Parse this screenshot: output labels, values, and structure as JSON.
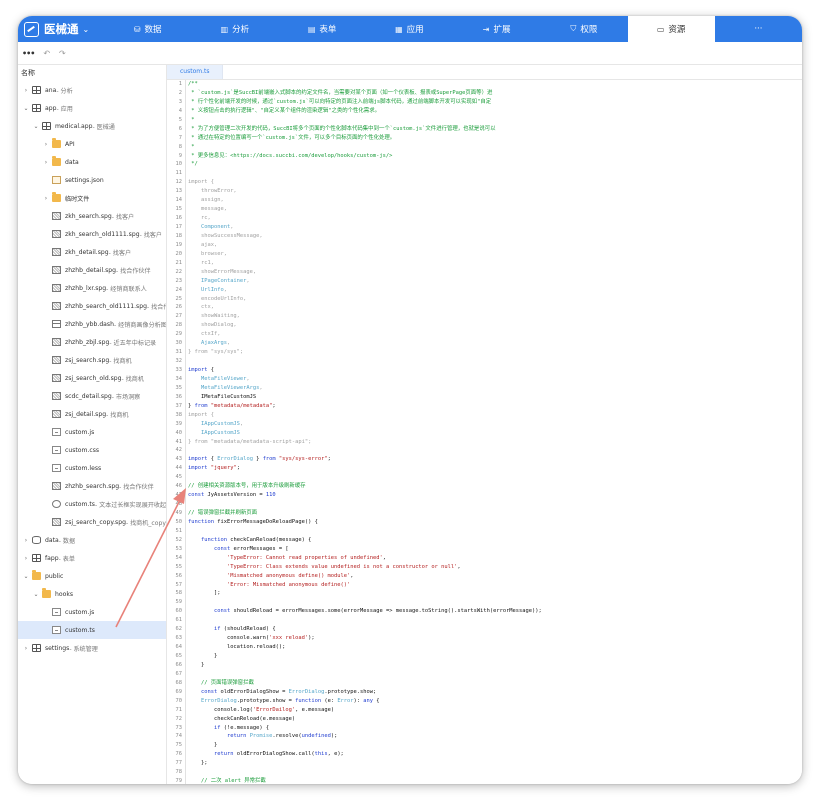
{
  "app": {
    "name": "医械通",
    "caret": "⌄"
  },
  "nav": [
    {
      "icon": "db",
      "label": "数据"
    },
    {
      "icon": "chart",
      "label": "分析"
    },
    {
      "icon": "table",
      "label": "表单"
    },
    {
      "icon": "grid",
      "label": "应用"
    },
    {
      "icon": "ext",
      "label": "扩展"
    },
    {
      "icon": "shield",
      "label": "权限"
    },
    {
      "icon": "folder",
      "label": "资源",
      "active": true
    },
    {
      "icon": "",
      "label": "···"
    }
  ],
  "subbar": {
    "menu": "•••",
    "undo": "↶",
    "redo": "↷"
  },
  "sidebar": {
    "header": "名称",
    "rows": [
      {
        "arrow": "›",
        "icon": "app",
        "label": "ana",
        "desc": " - 分析",
        "indent": 0
      },
      {
        "arrow": "⌄",
        "icon": "app",
        "label": "app",
        "desc": " - 应用",
        "indent": 0
      },
      {
        "arrow": "⌄",
        "icon": "app",
        "label": "medical.app",
        "desc": " - 医械通",
        "indent": 1
      },
      {
        "arrow": "›",
        "icon": "folder",
        "label": "API",
        "desc": "",
        "indent": 2
      },
      {
        "arrow": "›",
        "icon": "folder",
        "label": "data",
        "desc": "",
        "indent": 2
      },
      {
        "arrow": "",
        "icon": "json",
        "label": "settings.json",
        "desc": "",
        "indent": 2
      },
      {
        "arrow": "›",
        "icon": "folder",
        "label": "临时文件",
        "desc": "",
        "indent": 2
      },
      {
        "arrow": "",
        "icon": "spg",
        "label": "zkh_search.spg",
        "desc": " - 找客户",
        "indent": 2
      },
      {
        "arrow": "",
        "icon": "spg",
        "label": "zkh_search_old1111.spg",
        "desc": " - 找客户",
        "indent": 2
      },
      {
        "arrow": "",
        "icon": "spg",
        "label": "zkh_detail.spg",
        "desc": " - 找客户",
        "indent": 2
      },
      {
        "arrow": "",
        "icon": "spg",
        "label": "zhzhb_detail.spg",
        "desc": " - 找合作伙伴",
        "indent": 2
      },
      {
        "arrow": "",
        "icon": "spg",
        "label": "zhzhb_lxr.spg",
        "desc": " - 经销商联系人",
        "indent": 2
      },
      {
        "arrow": "",
        "icon": "spg",
        "label": "zhzhb_search_old1111.spg",
        "desc": " - 找合作伙伴",
        "indent": 2
      },
      {
        "arrow": "",
        "icon": "dash",
        "label": "zhzhb_ybb.dash",
        "desc": " - 经销商画像分析图",
        "indent": 2
      },
      {
        "arrow": "",
        "icon": "spg",
        "label": "zhzhb_zbjl.spg",
        "desc": " - 近五年中标记录",
        "indent": 2
      },
      {
        "arrow": "",
        "icon": "spg",
        "label": "zsj_search.spg",
        "desc": " - 找商机",
        "indent": 2
      },
      {
        "arrow": "",
        "icon": "spg",
        "label": "zsj_search_old.spg",
        "desc": " - 找商机",
        "indent": 2
      },
      {
        "arrow": "",
        "icon": "spg",
        "label": "scdc_detail.spg",
        "desc": " - 市场洞察",
        "indent": 2
      },
      {
        "arrow": "",
        "icon": "spg",
        "label": "zsj_detail.spg",
        "desc": " - 找商机",
        "indent": 2
      },
      {
        "arrow": "",
        "icon": "file",
        "label": "custom.js",
        "desc": "",
        "indent": 2
      },
      {
        "arrow": "",
        "icon": "file",
        "label": "custom.css",
        "desc": "",
        "indent": 2
      },
      {
        "arrow": "",
        "icon": "file",
        "label": "custom.less",
        "desc": "",
        "indent": 2
      },
      {
        "arrow": "",
        "icon": "spg",
        "label": "zhzhb_search.spg",
        "desc": " - 找合作伙伴",
        "indent": 2
      },
      {
        "arrow": "",
        "icon": "cmp",
        "label": "custom.ts",
        "desc": " - 文本过长框实现展开收起",
        "indent": 2
      },
      {
        "arrow": "",
        "icon": "spg",
        "label": "zsj_search_copy.spg",
        "desc": " - 找商机_copy",
        "indent": 2
      },
      {
        "arrow": "›",
        "icon": "db",
        "label": "data",
        "desc": " - 数据",
        "indent": 0
      },
      {
        "arrow": "›",
        "icon": "app",
        "label": "fapp",
        "desc": " - 表单",
        "indent": 0
      },
      {
        "arrow": "⌄",
        "icon": "folder",
        "label": "public",
        "desc": "",
        "indent": 0
      },
      {
        "arrow": "⌄",
        "icon": "folder",
        "label": "hooks",
        "desc": "",
        "indent": 1
      },
      {
        "arrow": "",
        "icon": "file",
        "label": "custom.js",
        "desc": "",
        "indent": 2
      },
      {
        "arrow": "",
        "icon": "file",
        "label": "custom.ts",
        "desc": "",
        "indent": 2,
        "selected": true
      },
      {
        "arrow": "›",
        "icon": "app",
        "label": "settings",
        "desc": " - 系统管理",
        "indent": 0
      }
    ]
  },
  "editor": {
    "tab": "custom.ts",
    "colors": {
      "comment": "#1a9c3a",
      "keyword": "#1f3ccf",
      "string": "#b31d1d",
      "gray": "#a0a0a0",
      "cyan": "#55a6c9",
      "text": "#111111",
      "num": "#1f3ccf"
    },
    "lines": [
      [
        [
          "c",
          "/**"
        ]
      ],
      [
        [
          "c",
          " * `custom.js`是SuccBI前端嵌入式脚本的约定文件名，当需要对某个页面（如一个仪表板、报表或SuperPage页面等）进"
        ]
      ],
      [
        [
          "c",
          " * 行个性化前端开发的时候，通过`custom.js`可以向特定的页面注入前端js脚本代码，通过前端脚本开发可以实现如\"自定"
        ]
      ],
      [
        [
          "c",
          " * 义按钮点击的执行逻辑\"、\"自定义某个组件的渲染逻辑\"之类的个性化需求。"
        ]
      ],
      [
        [
          "c",
          " *"
        ]
      ],
      [
        [
          "c",
          " * 为了方便管理二次开发的代码，SuccBI将多个页面的个性化脚本代码集中到一个`custom.js`文件进行管理，也就是说可以"
        ]
      ],
      [
        [
          "c",
          " * 通过在特定的位置编写一个`custom.js`文件，可以多个目标页面的个性化处理。"
        ]
      ],
      [
        [
          "c",
          " *"
        ]
      ],
      [
        [
          "c",
          " * 更多信息见：<https://docs.succbi.com/develop/hooks/custom-js/>"
        ]
      ],
      [
        [
          "c",
          " */"
        ]
      ],
      [],
      [
        [
          "g",
          "import {"
        ]
      ],
      [
        [
          "g",
          "    throwError,"
        ]
      ],
      [
        [
          "g",
          "    assign,"
        ]
      ],
      [
        [
          "g",
          "    message,"
        ]
      ],
      [
        [
          "g",
          "    rc,"
        ]
      ],
      [
        [
          "y",
          "    Component"
        ],
        [
          "g",
          ","
        ]
      ],
      [
        [
          "g",
          "    showSuccessMessage,"
        ]
      ],
      [
        [
          "g",
          "    ajax,"
        ]
      ],
      [
        [
          "g",
          "    browser,"
        ]
      ],
      [
        [
          "g",
          "    rc1,"
        ]
      ],
      [
        [
          "g",
          "    showErrorMessage,"
        ]
      ],
      [
        [
          "y",
          "    IPageContainer"
        ],
        [
          "g",
          ","
        ]
      ],
      [
        [
          "y",
          "    UrlInfo"
        ],
        [
          "g",
          ","
        ]
      ],
      [
        [
          "g",
          "    encodeUrlInfo,"
        ]
      ],
      [
        [
          "g",
          "    ctx,"
        ]
      ],
      [
        [
          "g",
          "    showWaiting,"
        ]
      ],
      [
        [
          "g",
          "    showDialog,"
        ]
      ],
      [
        [
          "g",
          "    ctxIf,"
        ]
      ],
      [
        [
          "y",
          "    AjaxArgs"
        ],
        [
          "g",
          ","
        ]
      ],
      [
        [
          "g",
          "} from \"sys/sys\";"
        ]
      ],
      [],
      [
        [
          "k",
          "import"
        ],
        [
          "t",
          " {"
        ]
      ],
      [
        [
          "y",
          "    MetaFileViewer"
        ],
        [
          "g",
          ","
        ]
      ],
      [
        [
          "y",
          "    MetaFileViewerArgs"
        ],
        [
          "g",
          ","
        ]
      ],
      [
        [
          "t",
          "    IMetaFileCustomJS"
        ]
      ],
      [
        [
          "t",
          "} "
        ],
        [
          "k",
          "from"
        ],
        [
          "t",
          " "
        ],
        [
          "s",
          "\"metadata/metadata\""
        ],
        [
          "t",
          ";"
        ]
      ],
      [
        [
          "g",
          "import {"
        ]
      ],
      [
        [
          "y",
          "    IAppCustomJS"
        ],
        [
          "g",
          ","
        ]
      ],
      [
        [
          "y",
          "    IAppCustomJS"
        ]
      ],
      [
        [
          "g",
          "} from \"metadata/metadata-script-api\";"
        ]
      ],
      [],
      [
        [
          "k",
          "import"
        ],
        [
          "t",
          " { "
        ],
        [
          "y",
          "ErrorDialog"
        ],
        [
          "t",
          " } "
        ],
        [
          "k",
          "from"
        ],
        [
          "t",
          " "
        ],
        [
          "s",
          "\"sys/sys-error\""
        ],
        [
          "t",
          ";"
        ]
      ],
      [
        [
          "k",
          "import"
        ],
        [
          "t",
          " "
        ],
        [
          "s",
          "\"jquery\""
        ],
        [
          "t",
          ";"
        ]
      ],
      [],
      [
        [
          "c",
          "// 创建相关资源版本号，用于版本升级刷新缓存"
        ]
      ],
      [
        [
          "k",
          "const"
        ],
        [
          "t",
          " JyAssetsVersion = "
        ],
        [
          "n",
          "110"
        ]
      ],
      [],
      [
        [
          "c",
          "// 错误弹窗拦截并刷新页面"
        ]
      ],
      [
        [
          "k",
          "function"
        ],
        [
          "t",
          " fixErrorMessageDoReloadPage() {"
        ]
      ],
      [],
      [
        [
          "t",
          "    "
        ],
        [
          "k",
          "function"
        ],
        [
          "t",
          " checkCanReload(message) {"
        ]
      ],
      [
        [
          "t",
          "        "
        ],
        [
          "k",
          "const"
        ],
        [
          "t",
          " errorMessages = ["
        ]
      ],
      [
        [
          "t",
          "            "
        ],
        [
          "s",
          "'TypeError: Cannot read properties of undefined'"
        ],
        [
          "t",
          ","
        ]
      ],
      [
        [
          "t",
          "            "
        ],
        [
          "s",
          "'TypeError: Class extends value undefined is not a constructor or null'"
        ],
        [
          "t",
          ","
        ]
      ],
      [
        [
          "t",
          "            "
        ],
        [
          "s",
          "'Mismatched anonymous define() module'"
        ],
        [
          "t",
          ","
        ]
      ],
      [
        [
          "t",
          "            "
        ],
        [
          "s",
          "'Error: Mismatched anonymous define()'"
        ]
      ],
      [
        [
          "t",
          "        ];"
        ]
      ],
      [],
      [
        [
          "t",
          "        "
        ],
        [
          "k",
          "const"
        ],
        [
          "t",
          " shouldReload = errorMessages.some(errorMessage => message.toString().startsWith(errorMessage));"
        ]
      ],
      [],
      [
        [
          "t",
          "        "
        ],
        [
          "k",
          "if"
        ],
        [
          "t",
          " (shouldReload) {"
        ]
      ],
      [
        [
          "t",
          "            console.warn("
        ],
        [
          "s",
          "'xxx reload'"
        ],
        [
          "t",
          ");"
        ]
      ],
      [
        [
          "t",
          "            location.reload();"
        ]
      ],
      [
        [
          "t",
          "        }"
        ]
      ],
      [
        [
          "t",
          "    }"
        ]
      ],
      [],
      [
        [
          "t",
          "    "
        ],
        [
          "c",
          "// 页面错误弹窗拦截"
        ]
      ],
      [
        [
          "t",
          "    "
        ],
        [
          "k",
          "const"
        ],
        [
          "t",
          " oldErrorDialogShow = "
        ],
        [
          "y",
          "ErrorDialog"
        ],
        [
          "t",
          ".prototype.show;"
        ]
      ],
      [
        [
          "t",
          "    "
        ],
        [
          "y",
          "ErrorDialog"
        ],
        [
          "t",
          ".prototype.show = "
        ],
        [
          "k",
          "function"
        ],
        [
          "t",
          " (e: "
        ],
        [
          "y",
          "Error"
        ],
        [
          "t",
          "): "
        ],
        [
          "k",
          "any"
        ],
        [
          "t",
          " {"
        ]
      ],
      [
        [
          "t",
          "        console.log("
        ],
        [
          "s",
          "'ErrorDailog'"
        ],
        [
          "t",
          ", e.message)"
        ]
      ],
      [
        [
          "t",
          "        checkCanReload(e.message)"
        ]
      ],
      [
        [
          "t",
          "        "
        ],
        [
          "k",
          "if"
        ],
        [
          "t",
          " (!e.message) {"
        ]
      ],
      [
        [
          "t",
          "            "
        ],
        [
          "k",
          "return"
        ],
        [
          "t",
          " "
        ],
        [
          "y",
          "Promise"
        ],
        [
          "t",
          ".resolve("
        ],
        [
          "k",
          "undefined"
        ],
        [
          "t",
          ");"
        ]
      ],
      [
        [
          "t",
          "        }"
        ]
      ],
      [
        [
          "t",
          "        "
        ],
        [
          "k",
          "return"
        ],
        [
          "t",
          " oldErrorDialogShow.call("
        ],
        [
          "k",
          "this"
        ],
        [
          "t",
          ", e);"
        ]
      ],
      [
        [
          "t",
          "    };"
        ]
      ],
      [],
      [
        [
          "t",
          "    "
        ],
        [
          "c",
          "// 二次 alert 异常拦截"
        ]
      ]
    ]
  }
}
